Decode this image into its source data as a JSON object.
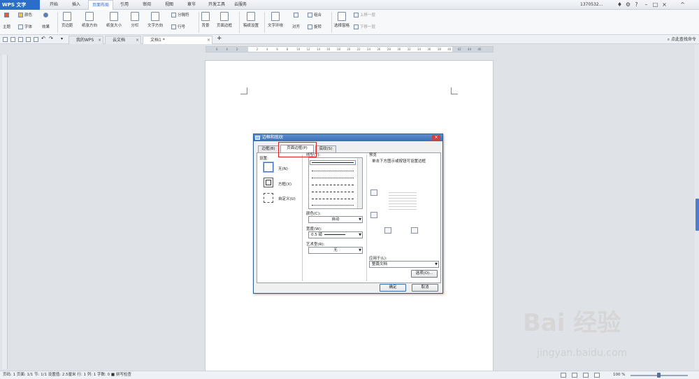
{
  "app": {
    "menu_label": "WPS 文字",
    "user": "1370532..."
  },
  "menu_tabs": [
    {
      "label": "开始"
    },
    {
      "label": "插入"
    },
    {
      "label": "页面布局"
    },
    {
      "label": "引用"
    },
    {
      "label": "审阅"
    },
    {
      "label": "视图"
    },
    {
      "label": "章节"
    },
    {
      "label": "开发工具"
    },
    {
      "label": "云服务"
    }
  ],
  "active_tab": "页面布局",
  "ribbon": {
    "theme": "主题",
    "color": "颜色",
    "font": "字体",
    "effect": "效果",
    "margin": "页边距",
    "orientation": "纸张方向",
    "size": "纸张大小",
    "columns": "分栏",
    "text_direction": "文字方向",
    "separator": "分隔符",
    "line_number": "行号",
    "background": "背景",
    "page_border": "页面边框",
    "draft_setting": "稿纸设置",
    "wrap": "文字环绕",
    "align": "对齐",
    "group": "组合",
    "rotate": "旋转",
    "select_pane": "选择窗格",
    "bring_forward": "上移一层",
    "send_backward": "下移一层"
  },
  "doc_tabs": [
    {
      "label": "我的WPS"
    },
    {
      "label": "云文档"
    },
    {
      "label": "文档1 *"
    }
  ],
  "search_label": "点此查找命令",
  "ruler_numbers": [
    "6",
    "4",
    "2",
    "",
    "2",
    "4",
    "6",
    "8",
    "10",
    "12",
    "14",
    "16",
    "18",
    "20",
    "22",
    "24",
    "26",
    "28",
    "30",
    "32",
    "34",
    "36",
    "38",
    "40",
    "42",
    "44",
    "46"
  ],
  "dialog": {
    "title": "边框和底纹",
    "tabs": [
      "边框(B)",
      "页面边框(P)",
      "底纹(S)"
    ],
    "setting_label": "设置:",
    "settings": [
      "无(N)",
      "方框(X)",
      "自定义(U)"
    ],
    "line_style_label": "线型(Y):",
    "color_label": "颜色(C):",
    "color_value": "自动",
    "width_label": "宽度(W):",
    "width_value": "0.5 磅",
    "art_label": "艺术型(R):",
    "art_value": "无",
    "preview_label": "预览",
    "preview_hint": "单击下方图示或按钮可设置边框",
    "apply_label": "应用于(L):",
    "apply_value": "整篇文档",
    "options_button": "选项(O)...",
    "ok_button": "确定",
    "cancel_button": "取消"
  },
  "status": {
    "text": "页码: 1  页面: 1/1  节: 1/1  设置值: 2.5厘米  行: 1  列: 1  字数: 0  ■ 拼写检查",
    "zoom": "100 %"
  },
  "watermark": {
    "main": "Bai 经验",
    "sub": "jingyan.baidu.com"
  }
}
